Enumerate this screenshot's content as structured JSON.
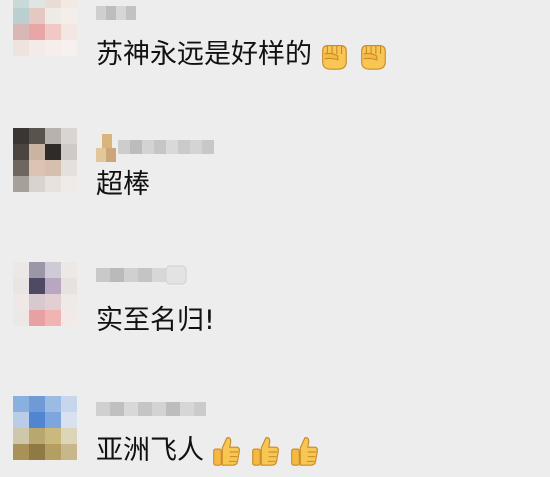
{
  "comments": [
    {
      "text": "苏神永远是好样的",
      "emojis": [
        "fist-icon",
        "fist-icon"
      ]
    },
    {
      "text": "超棒",
      "emojis": []
    },
    {
      "text": "实至名归!",
      "emojis": []
    },
    {
      "text": "亚洲飞人",
      "emojis": [
        "thumbs-up-icon",
        "thumbs-up-icon",
        "thumbs-up-icon"
      ]
    }
  ],
  "colors": {
    "background": "#ededed",
    "text": "#111111",
    "emoji_skin": "#f7c653"
  }
}
